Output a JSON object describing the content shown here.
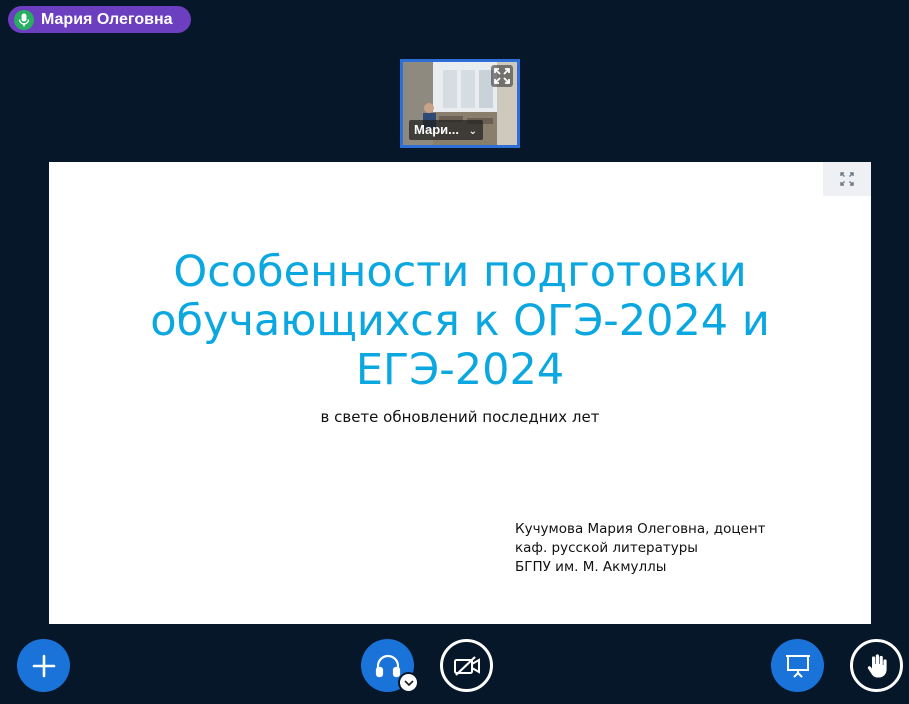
{
  "speaker": {
    "name": "Мария Олеговна",
    "icon": "microphone-icon"
  },
  "webcam": {
    "label": "Мари...",
    "expand_icon": "expand-icon",
    "menu_icon": "chevron-down-icon"
  },
  "slide": {
    "title": "Особенности подготовки обучающихся к ОГЭ-2024 и ЕГЭ-2024",
    "subtitle": "в свете обновлений последних лет",
    "author_lines": [
      "Кучумова Мария Олеговна, доцент",
      "каф. русской литературы",
      "БГПУ им. М. Акмуллы"
    ],
    "fullscreen_icon": "fullscreen-icon"
  },
  "toolbar": {
    "actions_icon": "plus-icon",
    "audio_icon": "headphones-icon",
    "audio_options_icon": "chevron-down-icon",
    "video_icon": "video-off-icon",
    "presentation_icon": "presentation-icon",
    "raise_hand_icon": "hand-icon"
  },
  "colors": {
    "background": "#06172a",
    "speaker_pill": "#6b3fc0",
    "accent_blue": "#1a73d9",
    "title_blue": "#0ba7e0"
  }
}
